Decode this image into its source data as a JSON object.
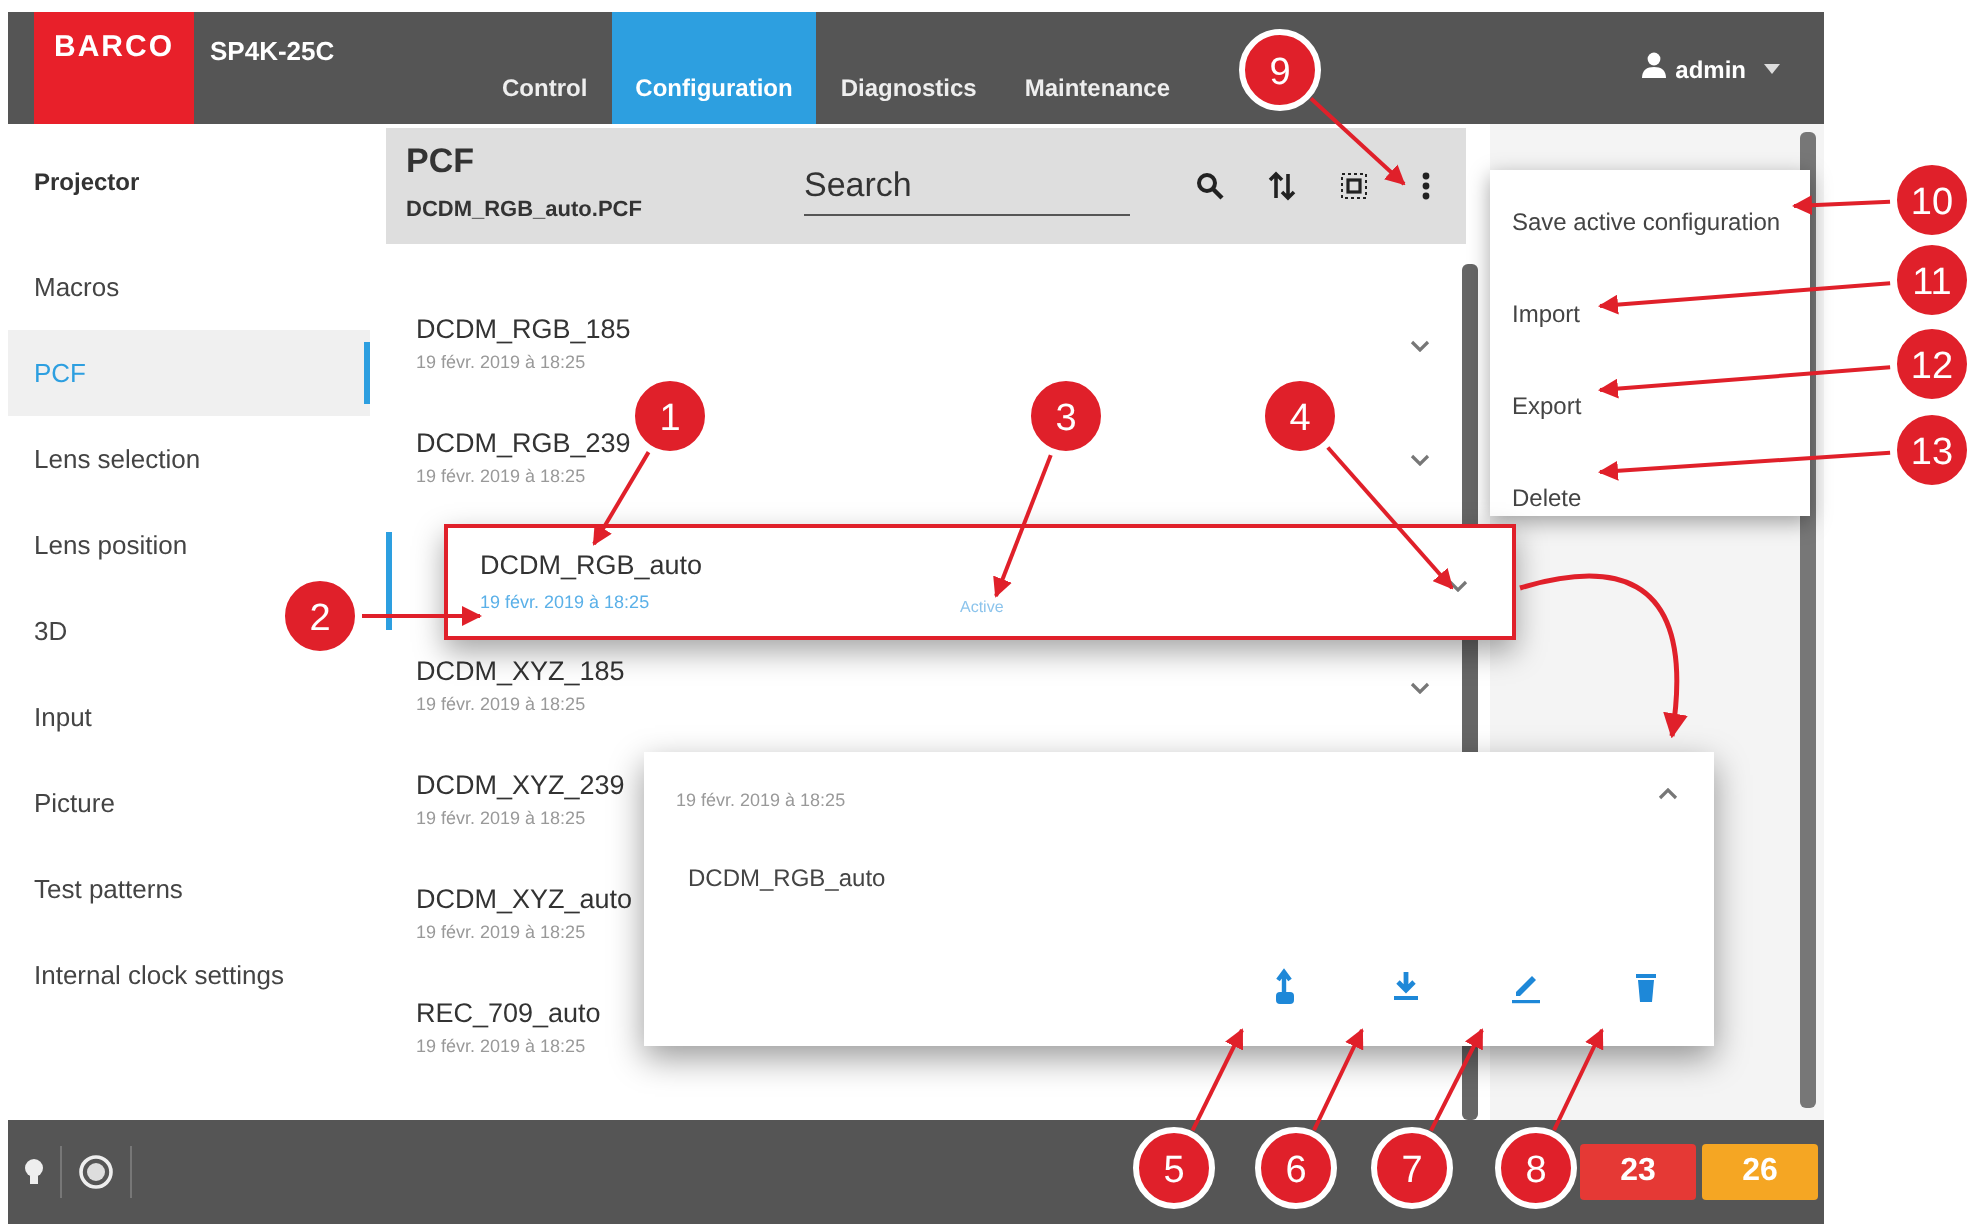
{
  "header": {
    "logo": "BARCO",
    "model": "SP4K-25C",
    "tabs": [
      {
        "label": "Control",
        "selected": false
      },
      {
        "label": "Configuration",
        "selected": true
      },
      {
        "label": "Diagnostics",
        "selected": false
      },
      {
        "label": "Maintenance",
        "selected": false
      }
    ],
    "user": "admin"
  },
  "sidebar": {
    "title": "Projector",
    "items": [
      {
        "label": "Macros",
        "selected": false
      },
      {
        "label": "PCF",
        "selected": true
      },
      {
        "label": "Lens selection",
        "selected": false
      },
      {
        "label": "Lens position",
        "selected": false
      },
      {
        "label": "3D",
        "selected": false
      },
      {
        "label": "Input",
        "selected": false
      },
      {
        "label": "Picture",
        "selected": false
      },
      {
        "label": "Test patterns",
        "selected": false
      },
      {
        "label": "Internal clock settings",
        "selected": false
      }
    ]
  },
  "panel": {
    "title": "PCF",
    "subtitle": "DCDM_RGB_auto.PCF",
    "search": {
      "placeholder": "Search"
    },
    "rows": [
      {
        "name": "DCDM_RGB_185",
        "date": "19 févr. 2019 à 18:25",
        "selected": false
      },
      {
        "name": "DCDM_RGB_239",
        "date": "19 févr. 2019 à 18:25",
        "selected": false
      },
      {
        "name": "DCDM_RGB_auto",
        "date": "19 févr. 2019 à 18:25",
        "selected": true,
        "status": "Active"
      },
      {
        "name": "DCDM_XYZ_185",
        "date": "19 févr. 2019 à 18:25",
        "selected": false
      },
      {
        "name": "DCDM_XYZ_239",
        "date": "19 févr. 2019 à 18:25",
        "selected": false
      },
      {
        "name": "DCDM_XYZ_auto",
        "date": "19 févr. 2019 à 18:25",
        "selected": false
      },
      {
        "name": "REC_709_auto",
        "date": "19 févr. 2019 à 18:25",
        "selected": false
      }
    ]
  },
  "details": {
    "date": "19 févr. 2019 à 18:25",
    "name": "DCDM_RGB_auto"
  },
  "menu": {
    "items": [
      "Save active configuration",
      "Import",
      "Export",
      "Delete"
    ]
  },
  "status_bar": {
    "badges": [
      {
        "text": "23",
        "color": "#e53935"
      },
      {
        "text": "26",
        "color": "#f5a623"
      }
    ]
  },
  "callouts": [
    "1",
    "2",
    "3",
    "4",
    "5",
    "6",
    "7",
    "8",
    "9",
    "10",
    "11",
    "12",
    "13"
  ]
}
